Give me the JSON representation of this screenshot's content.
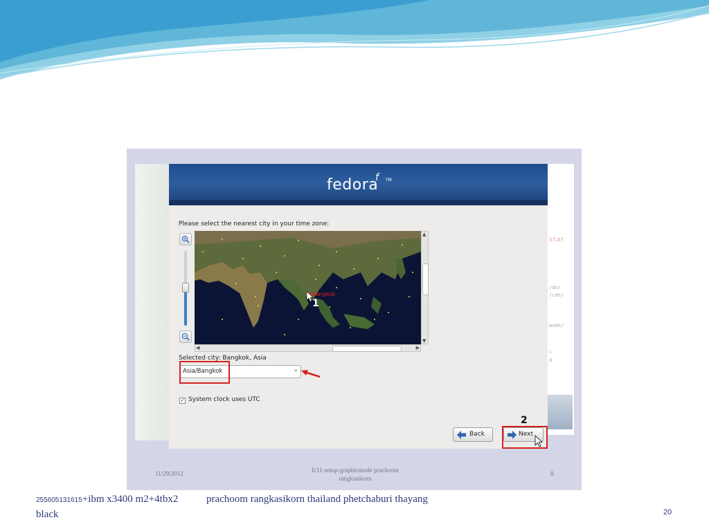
{
  "slide": {
    "footer_left_code": "255605131615",
    "footer_left_text": "+ibm x3400 m2+4tbx2 black",
    "footer_center": "prachoom rangkasikorn  thailand phetchaburi thayang",
    "page_number": "20"
  },
  "screenshot": {
    "footer_date": "11/29/2012",
    "footer_title": "fc11-setup-graphicmode prachoom rangkasikorn",
    "footer_page": "8",
    "annotation_1": "1",
    "annotation_2": "2",
    "annotation_color": "#d42020"
  },
  "installer": {
    "logo_text": "fedora",
    "logo_glyph": "f",
    "logo_tm": "TM",
    "prompt": "Please select the nearest city in your time zone:",
    "map_city_label": "Bangkok",
    "selected_city_label": "Selected city: Bangkok, Asia",
    "timezone_value": "Asia/Bangkok",
    "utc_checkbox_checked": true,
    "utc_checkbox_label": "System clock uses UTC",
    "back_button": "Back",
    "next_button": "Next",
    "icons": {
      "zoom_in": "zoom-in-icon",
      "zoom_out": "zoom-out-icon",
      "back": "left-arrow-icon",
      "next": "right-arrow-icon"
    }
  }
}
